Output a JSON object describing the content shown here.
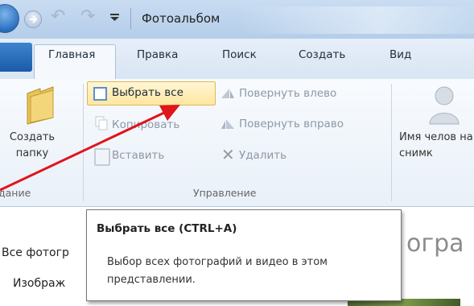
{
  "window": {
    "title": "Фотоальбом"
  },
  "tabs": [
    {
      "label": "Главная",
      "active": true
    },
    {
      "label": "Правка"
    },
    {
      "label": "Поиск"
    },
    {
      "label": "Создать"
    },
    {
      "label": "Вид"
    }
  ],
  "ribbon": {
    "create_group": {
      "button_label": "Создать папку",
      "group_label": "дание"
    },
    "manage_group": {
      "select_all": "Выбрать все",
      "rotate_left": "Повернуть влево",
      "copy": "Копировать",
      "rotate_right": "Повернуть вправо",
      "paste": "Вставить",
      "delete": "Удалить",
      "group_label": "Управление"
    },
    "people_button": "Имя челов на снимк"
  },
  "navigation": {
    "items": [
      "Все фотогр",
      "Изображ"
    ]
  },
  "content": {
    "heading": "огра"
  },
  "tooltip": {
    "title": "Выбрать все (CTRL+A)",
    "body": "Выбор всех фотографий и видео в этом представлении."
  },
  "colors": {
    "accent": "#1b5aa8",
    "highlight": "#ffe6a0",
    "arrow": "#e0141b"
  },
  "icons": [
    "back-icon",
    "forward-icon",
    "undo-icon",
    "redo-icon",
    "folder-icon",
    "select-all-icon",
    "rotate-left-icon",
    "copy-icon",
    "rotate-right-icon",
    "paste-icon",
    "delete-icon",
    "person-icon"
  ]
}
